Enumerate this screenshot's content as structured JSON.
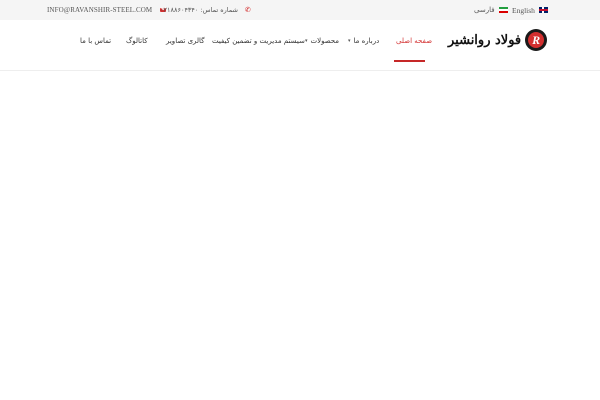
{
  "topbar": {
    "email": "INFO@RAVANSHIR-STEEL.COM",
    "phone": "شماره تماس: ۰۲۱۸۸۶۰۴۳۴۰",
    "lang_fa": "فارسی",
    "lang_en": "English",
    "icons": {
      "email": "envelope-icon",
      "phone": "phone-icon",
      "fa": "iran-flag-icon",
      "en": "uk-flag-icon"
    }
  },
  "brand": {
    "logo_letter": "R",
    "name": "فولاد روانشیر",
    "accent": "#d32f2f"
  },
  "nav": {
    "items": [
      {
        "label": "صفحه اصلی",
        "active": true
      },
      {
        "label": "درباره ما",
        "dropdown": true
      },
      {
        "label": "محصولات",
        "dropdown": true
      },
      {
        "label": "سیستم مدیریت و تضمین کیفیت"
      },
      {
        "label": "گالری تصاویر"
      },
      {
        "label": "کاتالوگ"
      },
      {
        "label": "تماس با ما"
      }
    ]
  }
}
